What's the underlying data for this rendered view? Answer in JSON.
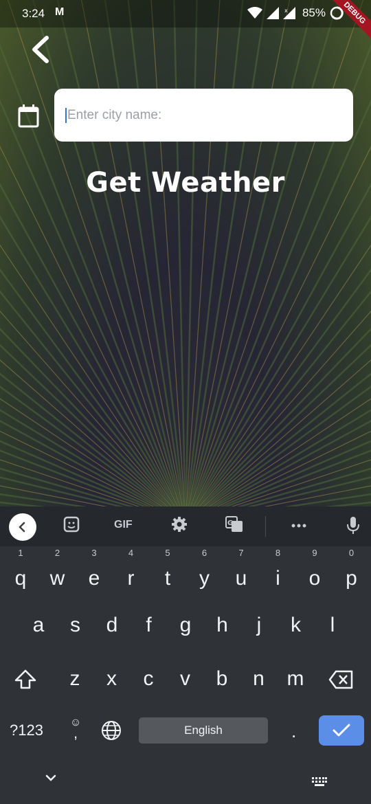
{
  "status": {
    "time": "3:24",
    "mail_icon": "gmail-icon",
    "battery": "85%",
    "debug": "DEBUG"
  },
  "app": {
    "back_icon": "back-arrow-icon",
    "calendar_icon": "calendar-icon",
    "city_input": {
      "placeholder": "Enter city name:",
      "value": ""
    },
    "title": "Get Weather"
  },
  "keyboard": {
    "toolbar": {
      "gif": "GIF"
    },
    "row1": [
      {
        "k": "q",
        "h": "1"
      },
      {
        "k": "w",
        "h": "2"
      },
      {
        "k": "e",
        "h": "3"
      },
      {
        "k": "r",
        "h": "4"
      },
      {
        "k": "t",
        "h": "5"
      },
      {
        "k": "y",
        "h": "6"
      },
      {
        "k": "u",
        "h": "7"
      },
      {
        "k": "i",
        "h": "8"
      },
      {
        "k": "o",
        "h": "9"
      },
      {
        "k": "p",
        "h": "0"
      }
    ],
    "row2": [
      "a",
      "s",
      "d",
      "f",
      "g",
      "h",
      "j",
      "k",
      "l"
    ],
    "row3": [
      "z",
      "x",
      "c",
      "v",
      "b",
      "n",
      "m"
    ],
    "symbols_label": "?123",
    "comma_label": ",",
    "space_label": "English",
    "period_label": "."
  },
  "colors": {
    "accent": "#5b8ee6",
    "keyboard_bg": "#2f3338",
    "debug_banner": "#a31621"
  }
}
